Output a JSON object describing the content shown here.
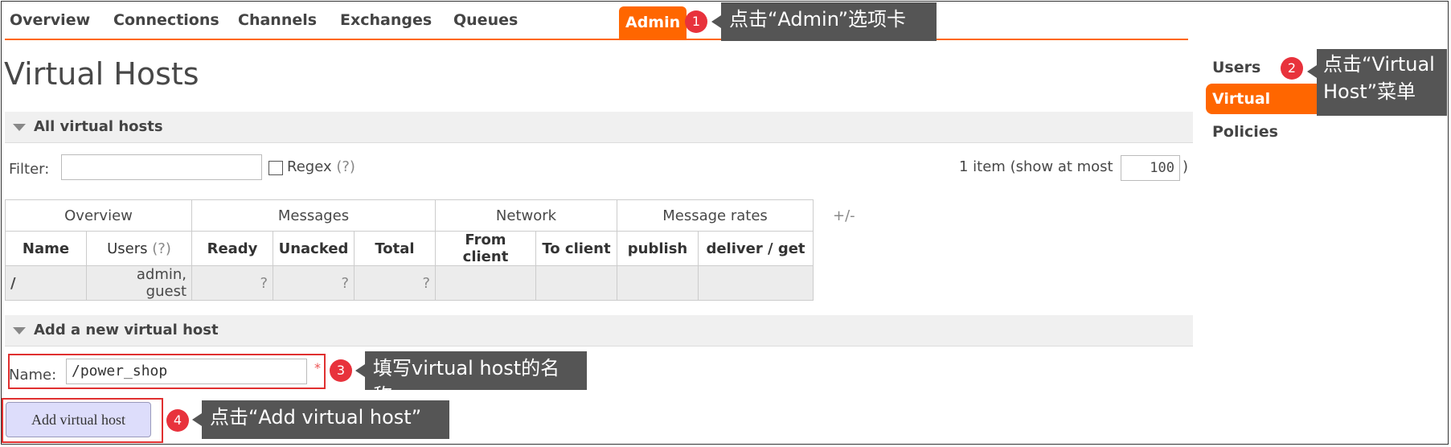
{
  "tabs": [
    "Overview",
    "Connections",
    "Channels",
    "Exchanges",
    "Queues",
    "Admin"
  ],
  "page_title": "Virtual Hosts",
  "section_all": "All virtual hosts",
  "filter": {
    "label": "Filter:",
    "value": "",
    "regex_label": "Regex",
    "help": "(?)"
  },
  "count": {
    "text": "1 item (show at most",
    "value": "100",
    "close": ")"
  },
  "table": {
    "groups": [
      "Overview",
      "Messages",
      "Network",
      "Message rates"
    ],
    "columns": [
      "Name",
      "Users",
      "(?)",
      "Ready",
      "Unacked",
      "Total",
      "From client",
      "To client",
      "publish",
      "deliver / get"
    ],
    "row": {
      "name": "/",
      "users": "admin, guest",
      "ready": "?",
      "unacked": "?",
      "total": "?",
      "from_client": "",
      "to_client": "",
      "publish": "",
      "deliver_get": ""
    },
    "toggle": "+/-"
  },
  "section_add": "Add a new virtual host",
  "form": {
    "name_label": "Name:",
    "name_value": "/power_shop",
    "required_mark": "*",
    "submit": "Add virtual host"
  },
  "sidebar": [
    "Users",
    "Virtual Hosts",
    "Policies"
  ],
  "annotations": [
    {
      "num": "1",
      "text": "点击“Admin”选项卡"
    },
    {
      "num": "2",
      "line1": "点击“Virtual",
      "line2": "Host”菜单"
    },
    {
      "num": "3",
      "text": "填写virtual host的名称"
    },
    {
      "num": "4",
      "text": "点击“Add virtual host”"
    }
  ],
  "colors": {
    "accent": "#ff6600",
    "annotation_badge": "#e8323c",
    "callout_bg": "#555555",
    "highlight_box": "#e03030"
  }
}
